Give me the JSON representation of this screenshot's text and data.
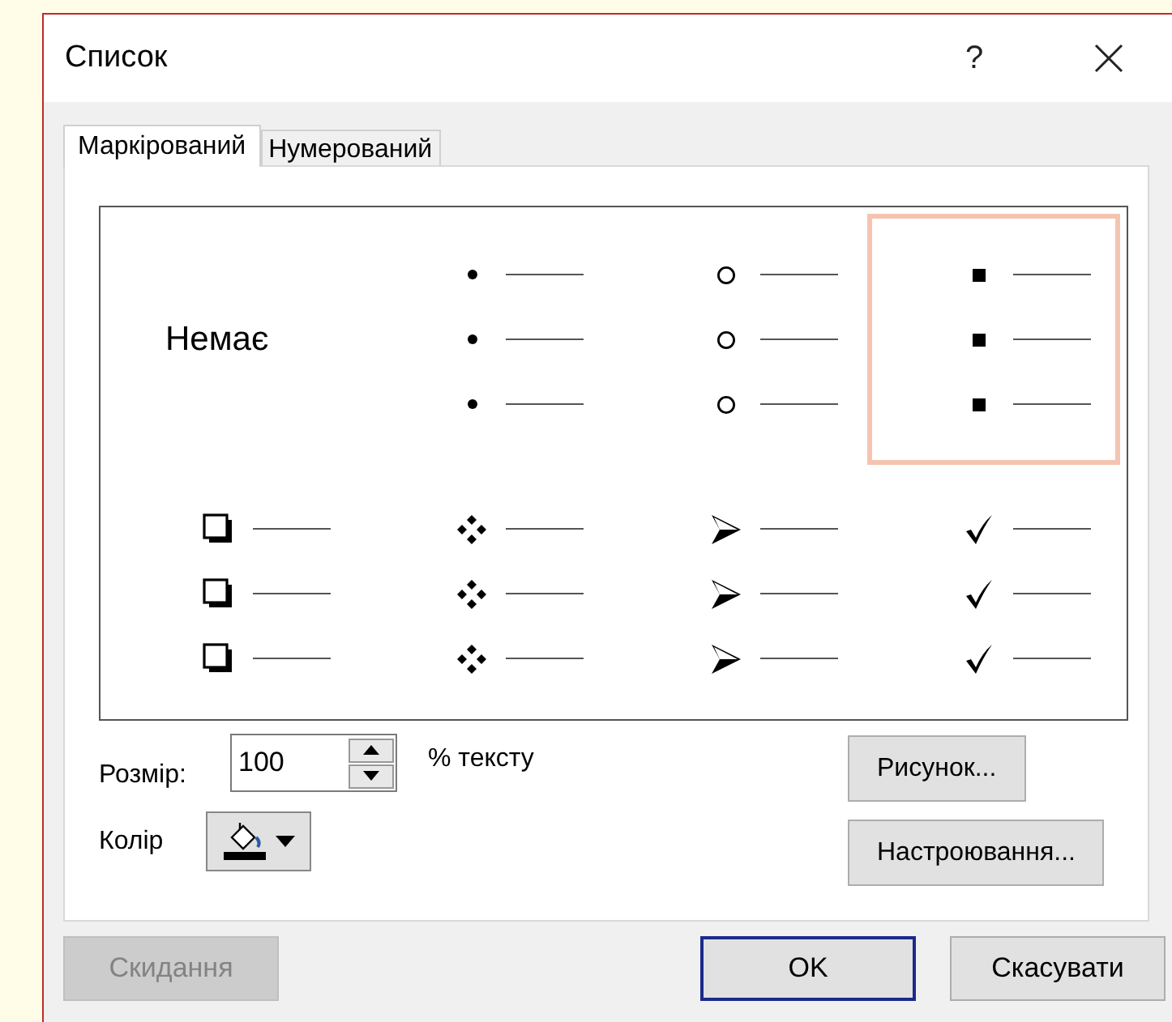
{
  "window": {
    "title": "Список",
    "help": "?"
  },
  "tabs": [
    {
      "label": "Маркірований",
      "selected": true
    },
    {
      "label": "Нумерований",
      "selected": false
    }
  ],
  "gallery": {
    "items": [
      {
        "kind": "none",
        "label": "Немає",
        "selected": false
      },
      {
        "kind": "bullet",
        "selected": false
      },
      {
        "kind": "circle",
        "selected": false
      },
      {
        "kind": "square",
        "selected": true
      },
      {
        "kind": "box",
        "selected": false
      },
      {
        "kind": "diamond",
        "selected": false
      },
      {
        "kind": "arrow",
        "selected": false
      },
      {
        "kind": "check",
        "selected": false
      }
    ]
  },
  "size": {
    "label": "Розмір:",
    "value": "100",
    "suffix": "% тексту"
  },
  "color": {
    "label": "Колір"
  },
  "side_buttons": [
    "Рисунок...",
    "Настроювання..."
  ],
  "buttons": [
    {
      "label": "Скидання",
      "disabled": true,
      "default": false
    },
    {
      "label": "OK",
      "disabled": false,
      "default": true
    },
    {
      "label": "Скасувати",
      "disabled": false,
      "default": false
    }
  ]
}
